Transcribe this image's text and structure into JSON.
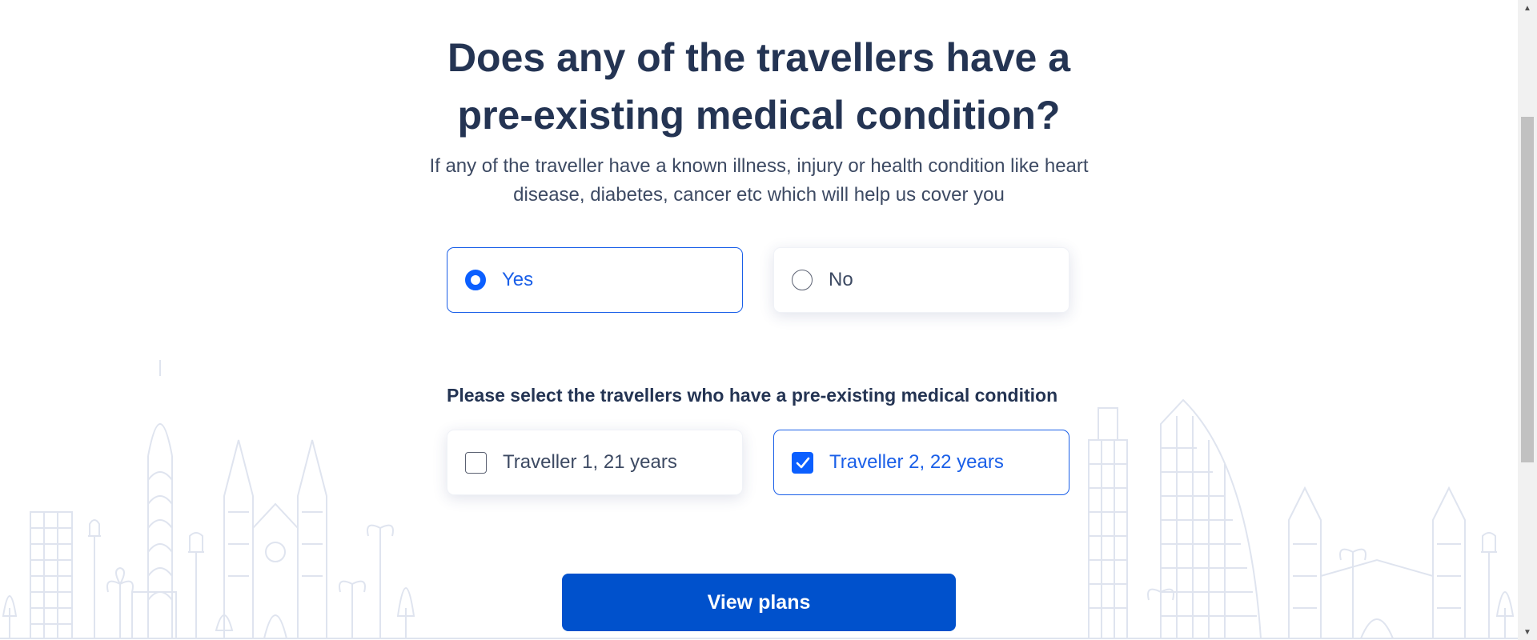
{
  "question": {
    "title": "Does any of the travellers have a pre-existing medical condition?",
    "subtitle": "If any of the traveller have a known illness, injury or health condition like heart disease, diabetes, cancer etc which will help us cover you"
  },
  "condition_options": [
    {
      "label": "Yes",
      "selected": true
    },
    {
      "label": "No",
      "selected": false
    }
  ],
  "travellers_section": {
    "label": "Please select the travellers who have a pre-existing medical condition",
    "travellers": [
      {
        "label": "Traveller 1, 21 years",
        "checked": false
      },
      {
        "label": "Traveller 2, 22 years",
        "checked": true
      }
    ]
  },
  "cta": {
    "label": "View plans"
  },
  "colors": {
    "heading": "#243453",
    "accent": "#0b5fff",
    "button": "#0051cc",
    "skyline": "#dfe4ef"
  }
}
